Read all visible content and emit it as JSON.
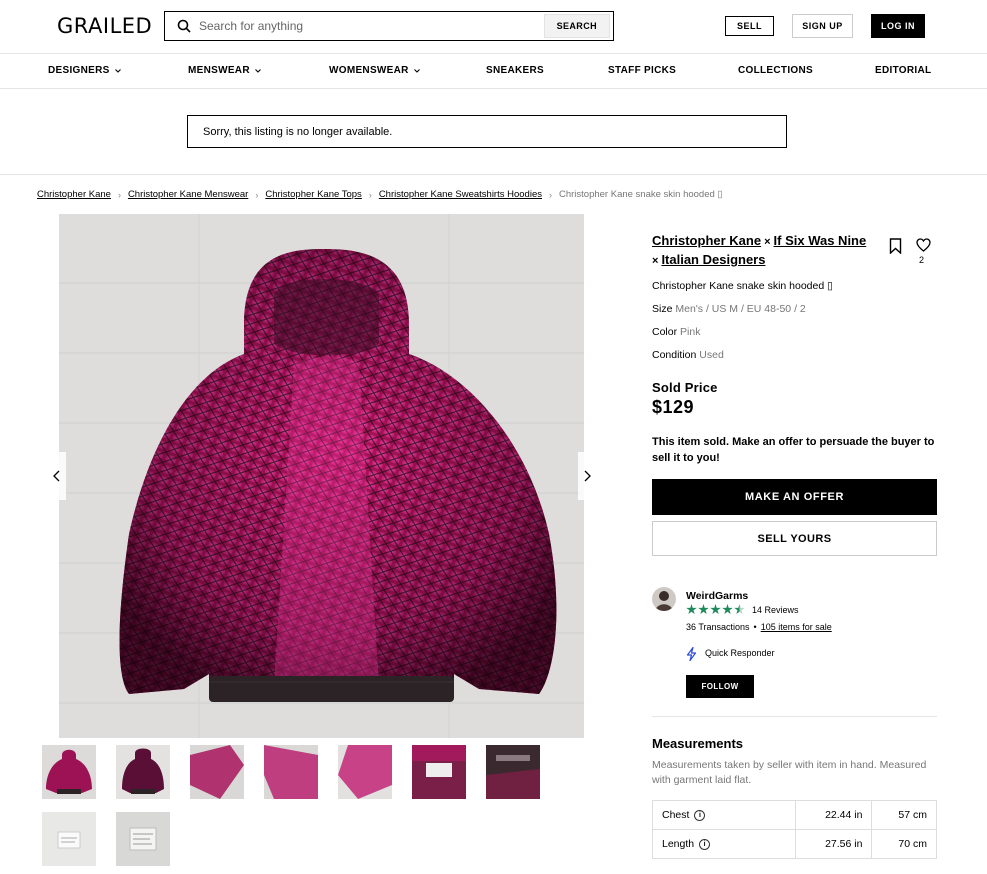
{
  "header": {
    "logo": "GRAILED",
    "search_placeholder": "Search for anything",
    "search_button": "SEARCH",
    "sell": "SELL",
    "sign_up": "SIGN UP",
    "log_in": "LOG IN"
  },
  "nav": [
    "DESIGNERS",
    "MENSWEAR",
    "WOMENSWEAR",
    "SNEAKERS",
    "STAFF PICKS",
    "COLLECTIONS",
    "EDITORIAL"
  ],
  "notice": "Sorry, this listing is no longer available.",
  "breadcrumbs": [
    "Christopher Kane",
    "Christopher Kane Menswear",
    "Christopher Kane Tops",
    "Christopher Kane Sweatshirts Hoodies",
    "Christopher Kane snake skin hooded ▯"
  ],
  "listing": {
    "brands": [
      "Christopher Kane",
      "If Six Was Nine",
      "Italian Designers"
    ],
    "brand_sep": "×",
    "favorites": "2",
    "title": "Christopher Kane snake skin hooded ▯",
    "size_label": "Size",
    "size": "Men's / US M / EU 48-50 / 2",
    "color_label": "Color",
    "color": "Pink",
    "condition_label": "Condition",
    "condition": "Used",
    "sold_price_label": "Sold Price",
    "sold_price": "$129",
    "sold_message": "This item sold. Make an offer to persuade the buyer to sell it to you!",
    "make_offer": "MAKE AN OFFER",
    "sell_yours": "SELL YOURS"
  },
  "seller": {
    "name": "WeirdGarms",
    "rating": 4.5,
    "reviews": "14 Reviews",
    "transactions": "36 Transactions",
    "bullet": "•",
    "items_for_sale": "105 items for sale",
    "badge": "Quick Responder",
    "follow": "FOLLOW"
  },
  "measurements": {
    "title": "Measurements",
    "note": "Measurements taken by seller with item in hand. Measured with garment laid flat.",
    "rows": [
      {
        "label": "Chest",
        "inches": "22.44 in",
        "cm": "57 cm"
      },
      {
        "label": "Length",
        "inches": "27.56 in",
        "cm": "70 cm"
      }
    ]
  },
  "colors": {
    "accent": "#000000",
    "hoodie_pink": "#c8186a",
    "rating_green": "#1f8a5a"
  }
}
